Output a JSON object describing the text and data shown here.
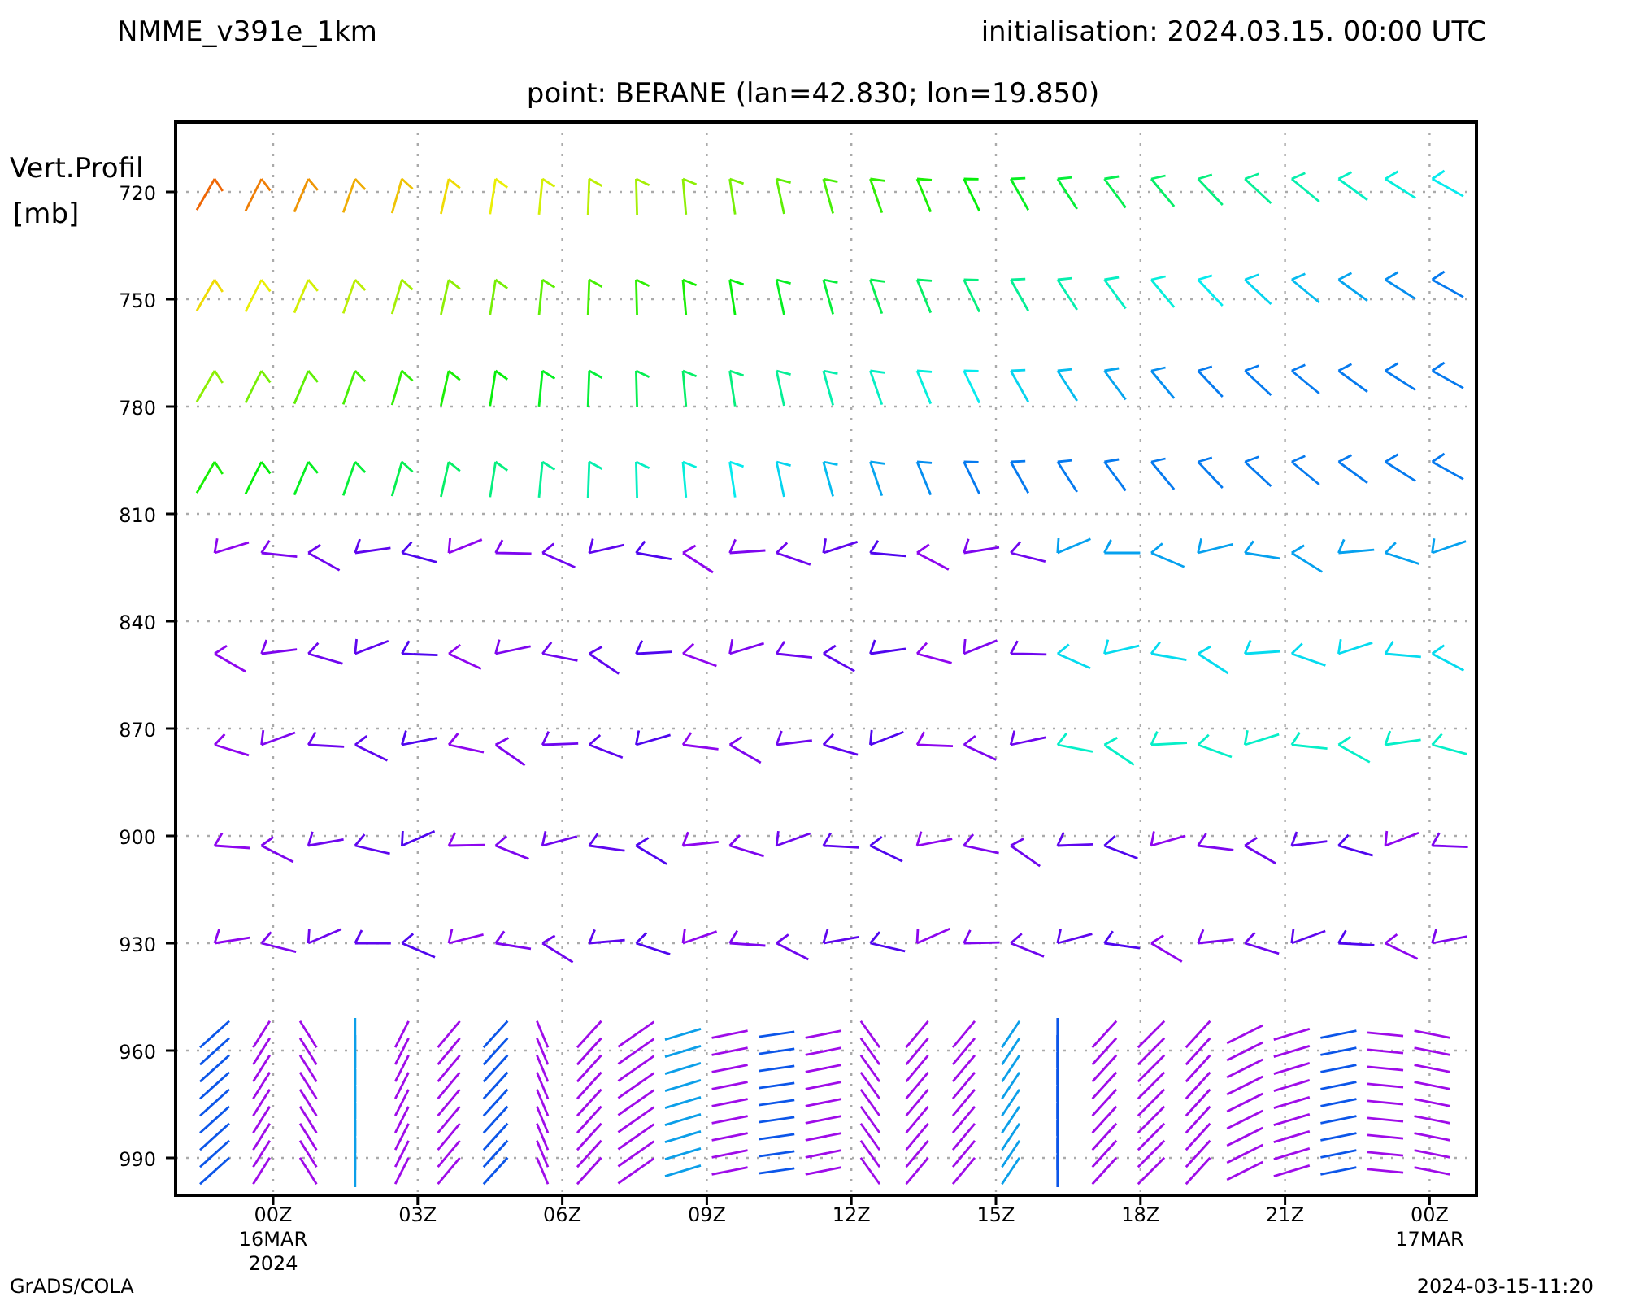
{
  "title": "NMME_v391e_1km",
  "initialisation": "initialisation: 2024.03.15. 00:00 UTC",
  "subtitle": "point: BERANE (lan=42.830; lon=19.850)",
  "y_axis": {
    "title_lines": [
      "Vert.Profil",
      "[mb]"
    ],
    "ticks": [
      "720",
      "750",
      "780",
      "810",
      "840",
      "870",
      "900",
      "930",
      "960",
      "990"
    ]
  },
  "x_axis": {
    "ticks": [
      {
        "label": "00Z",
        "lines": [
          "16MAR",
          "2024"
        ]
      },
      {
        "label": "03Z"
      },
      {
        "label": "06Z"
      },
      {
        "label": "09Z"
      },
      {
        "label": "12Z"
      },
      {
        "label": "15Z"
      },
      {
        "label": "18Z"
      },
      {
        "label": "21Z"
      },
      {
        "label": "00Z",
        "lines": [
          "17MAR"
        ]
      }
    ]
  },
  "footer_left": "GrADS/COLA",
  "footer_right": "2024-03-15-11:20"
}
